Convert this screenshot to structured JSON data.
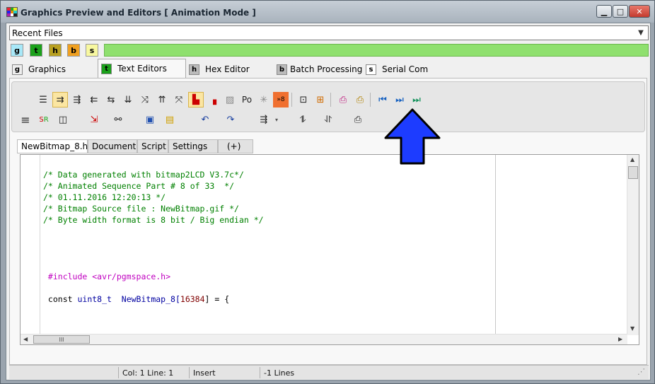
{
  "window": {
    "title": "Graphics Preview and Editors [ Animation Mode ]",
    "controls": {
      "minimize": "▁",
      "maximize": "□",
      "close": "✕"
    }
  },
  "recent_files": {
    "value": "Recent Files",
    "dropdown_icon": "chevron-down-icon"
  },
  "mode_chips": [
    {
      "letter": "g",
      "color": "#a8e8f8"
    },
    {
      "letter": "t",
      "color": "#1aa01a"
    },
    {
      "letter": "h",
      "color": "#b8a020"
    },
    {
      "letter": "b",
      "color": "#f0a020"
    },
    {
      "letter": "s",
      "color": "#f8f8a0"
    }
  ],
  "main_tabs": [
    {
      "letter": "g",
      "label": "Graphics"
    },
    {
      "letter": "t",
      "label": "Text Editors"
    },
    {
      "letter": "h",
      "label": "Hex Editor"
    },
    {
      "letter": "b",
      "label": "Batch Processing"
    },
    {
      "letter": "s",
      "label": "Serial Com"
    }
  ],
  "toolbar": {
    "row1_text_button": "Po",
    "row1_badge": "»8"
  },
  "doc_tabs": [
    "NewBitmap_8.h",
    "Document",
    "Script",
    "Settings",
    "(+)"
  ],
  "code_lines": [
    {
      "text": "/* Data generated with bitmap2LCD V3.7c*/",
      "kind": "comment"
    },
    {
      "text": "/* Animated Sequence Part # 8 of 33  */",
      "kind": "comment"
    },
    {
      "text": "/* 01.11.2016 12:20:13 */",
      "kind": "comment"
    },
    {
      "text": "/* Bitmap Source file : NewBitmap.gif */",
      "kind": "comment"
    },
    {
      "text": "/* Byte width format is 8 bit / Big endian */",
      "kind": "comment"
    }
  ],
  "code_include": {
    "directive": " #include",
    "header": " <avr/pgmspace.h>"
  },
  "code_decl": {
    "keyword": " const ",
    "type": "uint8_t",
    "name": "  NewBitmap_8",
    "bracket_open": "[",
    "size": "16384",
    "rest": "] = {"
  },
  "hscroll_grip": "III",
  "status": {
    "position": "Col: 1 Line: 1",
    "mode": "Insert",
    "lines": "-1 Lines"
  },
  "colors": {
    "accent_arrow": "#1d3cff",
    "comment": "#008000",
    "preprocessor": "#c000c0",
    "type": "#0000a0",
    "number": "#800000"
  }
}
